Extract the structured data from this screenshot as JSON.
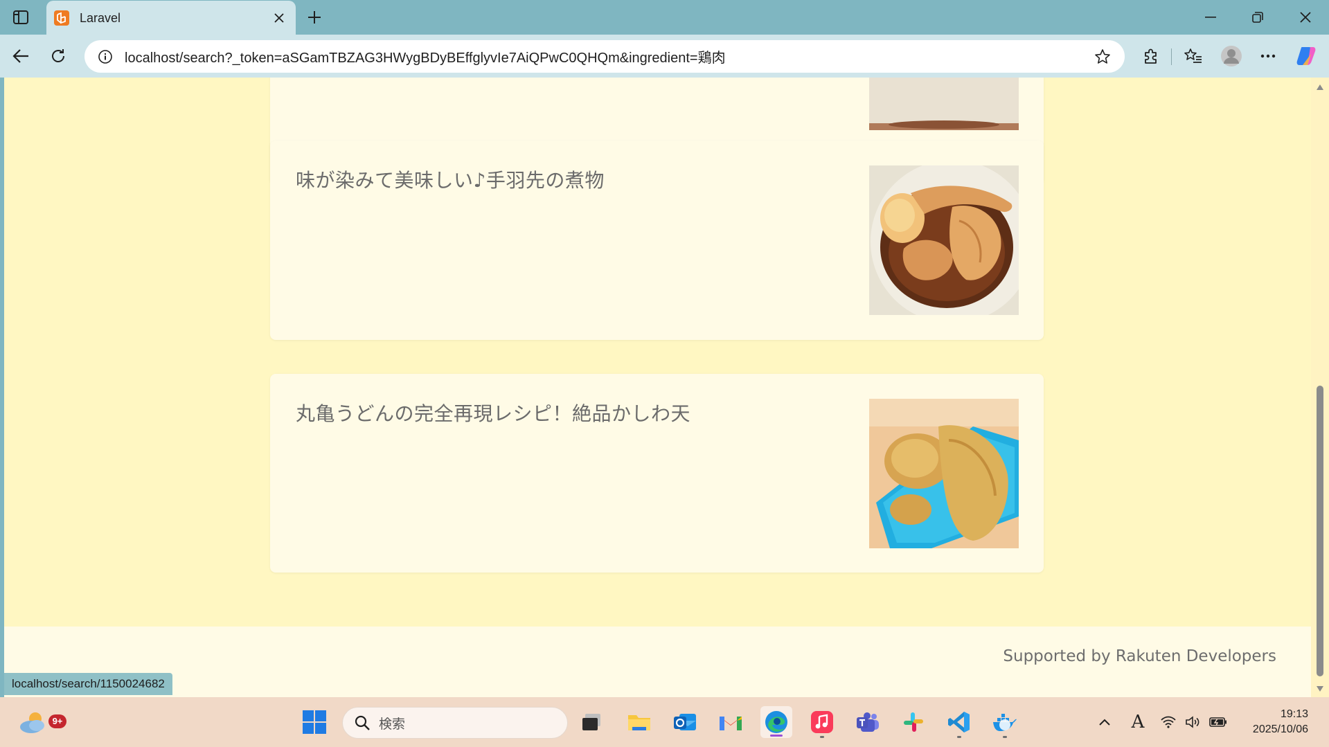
{
  "browser": {
    "tab_title": "Laravel",
    "address_url": "localhost/search?_token=aSGamTBZAG3HWygBDyBEffglyvIe7AiQPwC0QHQm&ingredient=鶏肉",
    "status_url": "localhost/search/1150024682"
  },
  "recipes": [
    {
      "title": ""
    },
    {
      "title": "味が染みて美味しい♪手羽先の煮物",
      "image": "chicken-wings-simmered-with-egg"
    },
    {
      "title": "丸亀うどんの完全再現レシピ！絶品かしわ天",
      "image": "chicken-tempura-on-blue-plate"
    }
  ],
  "footer": {
    "text": "Supported by Rakuten Developers"
  },
  "taskbar": {
    "search_placeholder": "検索",
    "weather_badge": "9+",
    "time": "19:13",
    "date": "2025/10/06",
    "ime_indicator": "A"
  },
  "colors": {
    "page_background": "#fff7c2",
    "card_background": "#fffbe6",
    "chrome_background": "#7fb6c1",
    "toolbar_background": "#cfe5ea",
    "taskbar_background": "#f1d9c7"
  }
}
